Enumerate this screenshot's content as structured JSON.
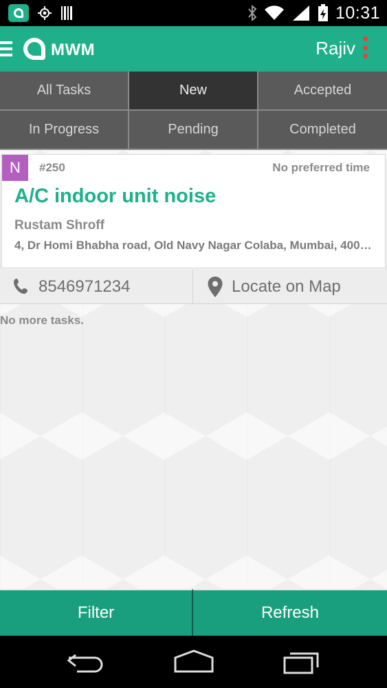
{
  "status_bar": {
    "time": "10:31",
    "icons": [
      "app-notification-icon",
      "gps-icon",
      "barcode-icon",
      "bluetooth-icon",
      "wifi-icon",
      "signal-icon",
      "battery-charging-icon"
    ]
  },
  "app_bar": {
    "brand": "MWM",
    "user": "Rajiv",
    "accent": "#1fb08b"
  },
  "tabs": [
    {
      "label": "All Tasks",
      "active": false
    },
    {
      "label": "New",
      "active": true
    },
    {
      "label": "Accepted",
      "active": false
    },
    {
      "label": "In Progress",
      "active": false
    },
    {
      "label": "Pending",
      "active": false
    },
    {
      "label": "Completed",
      "active": false
    }
  ],
  "task": {
    "badge": "N",
    "badge_color": "#b35fc0",
    "id": "#250",
    "preferred_time": "No preferred time",
    "title": "A/C indoor unit noise",
    "customer": "Rustam Shroff",
    "address": "4, Dr Homi Bhabha road, Old Navy Nagar Colaba, Mumbai, 400…",
    "phone": "8546971234",
    "map_label": "Locate on Map"
  },
  "list_footer": "No more tasks.",
  "bottom_buttons": {
    "filter": "Filter",
    "refresh": "Refresh"
  },
  "nav": {
    "icons": [
      "back-icon",
      "home-icon",
      "recents-icon"
    ]
  }
}
